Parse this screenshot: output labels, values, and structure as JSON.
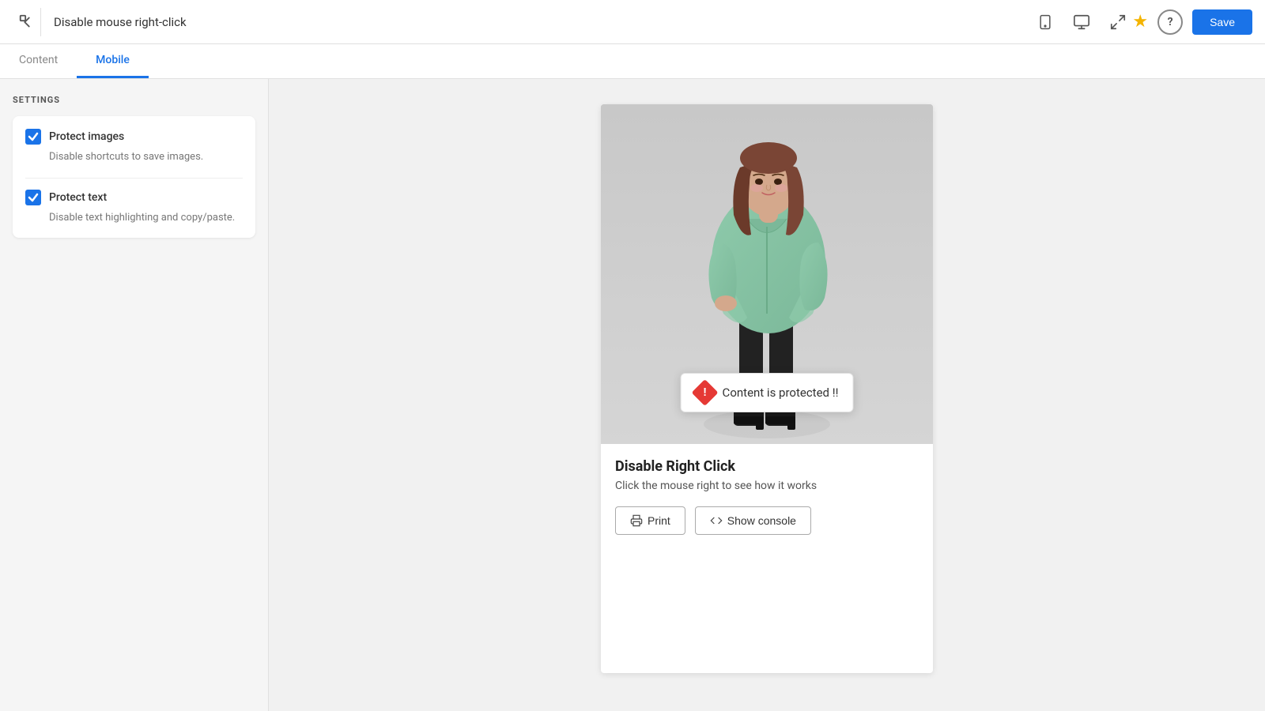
{
  "header": {
    "title": "Disable mouse right-click",
    "back_label": "←",
    "save_label": "Save",
    "star_icon": "★",
    "help_icon": "?"
  },
  "tabs": [
    {
      "id": "content",
      "label": "Content",
      "active": false
    },
    {
      "id": "mobile",
      "label": "Mobile",
      "active": true
    }
  ],
  "sidebar": {
    "settings_label": "SETTINGS",
    "settings_card": {
      "items": [
        {
          "id": "protect-images",
          "name": "Protect images",
          "desc": "Disable shortcuts to save images.",
          "checked": true
        },
        {
          "id": "protect-text",
          "name": "Protect text",
          "desc": "Disable text highlighting and copy/paste.",
          "checked": true
        }
      ]
    }
  },
  "preview": {
    "popup_text": "Content is protected !!",
    "title": "Disable Right Click",
    "subtitle": "Click the mouse right to see how it works",
    "btn_print": "Print",
    "btn_console": "Show console"
  },
  "icons": {
    "mobile": "📱",
    "desktop": "🖥",
    "expand": "⬚"
  }
}
